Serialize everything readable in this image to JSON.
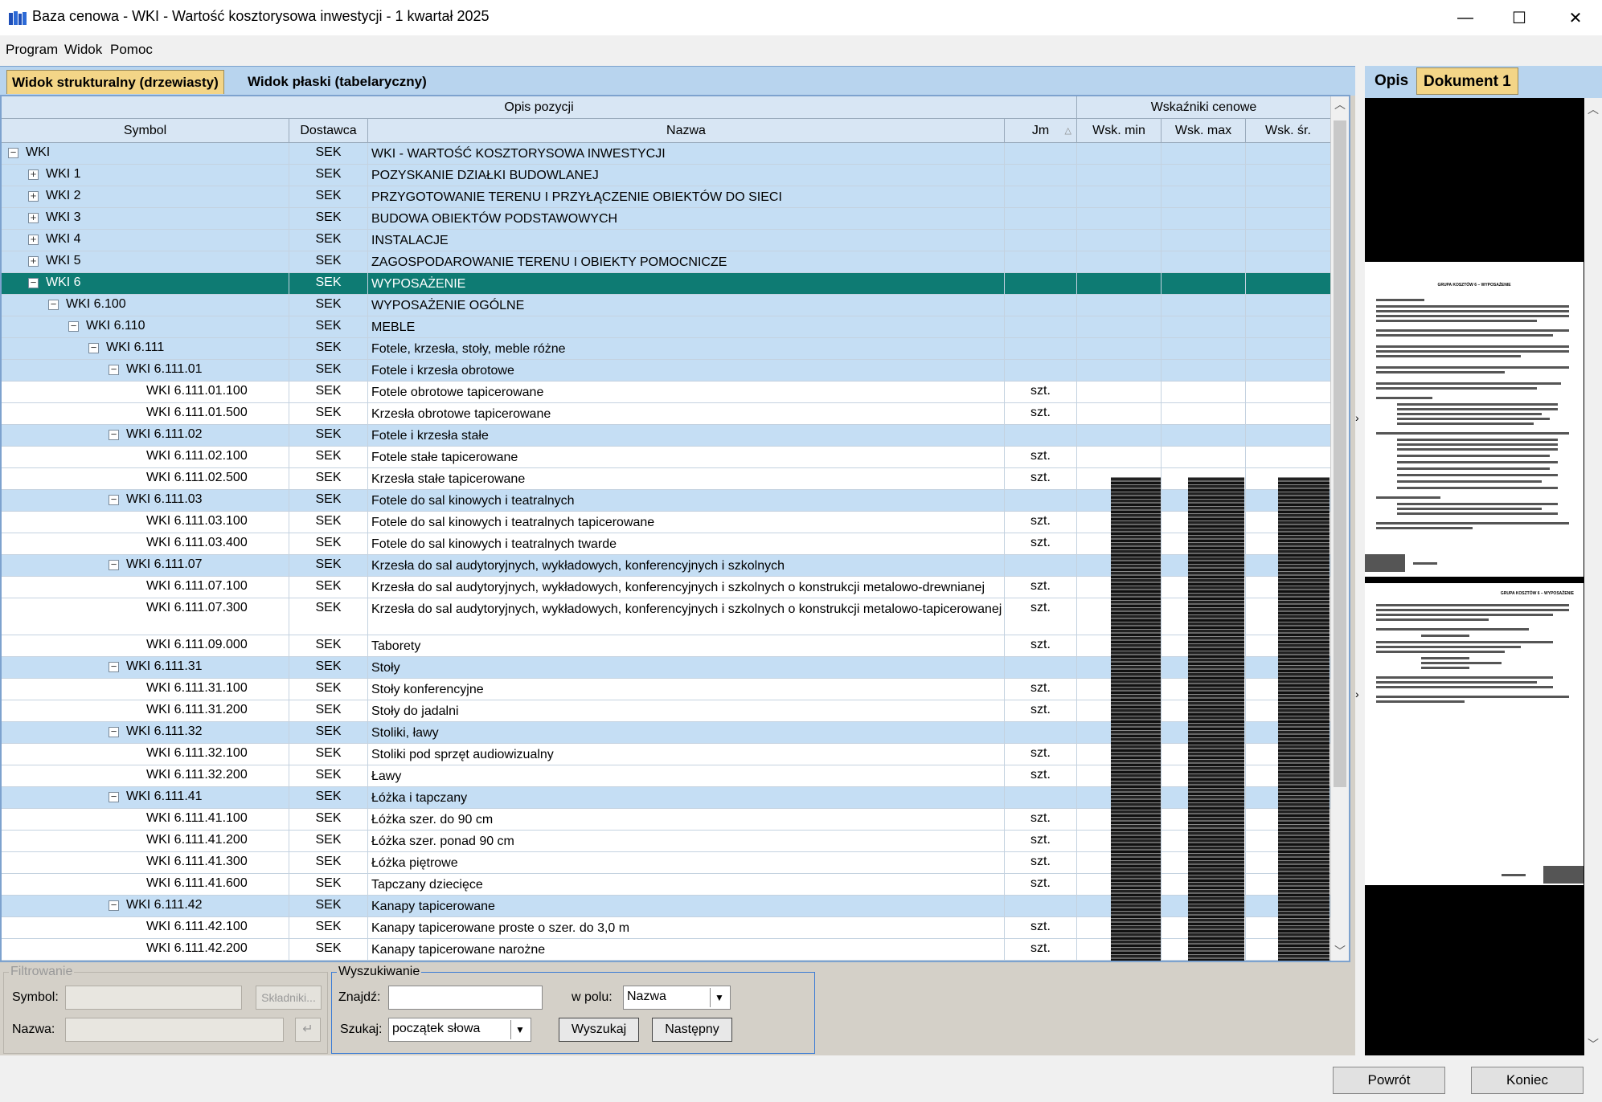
{
  "window": {
    "title": "Baza cenowa - WKI - Wartość kosztorysowa inwestycji - 1 kwartał 2025",
    "minimize": "—",
    "maximize": "☐",
    "close": "✕"
  },
  "menu": [
    {
      "label": "Program"
    },
    {
      "label": "Widok"
    },
    {
      "label": "Pomoc"
    }
  ],
  "tabs": [
    {
      "label": "Widok strukturalny (drzewiasty)"
    },
    {
      "label": "Widok płaski (tabelaryczny)"
    }
  ],
  "grid": {
    "group_headers": {
      "opis": "Opis pozycji",
      "wsk": "Wskaźniki cenowe"
    },
    "columns": {
      "symbol": "Symbol",
      "dostawca": "Dostawca",
      "nazwa": "Nazwa",
      "jm": "Jm",
      "wsk_min": "Wsk. min",
      "wsk_max": "Wsk. max",
      "wsk_sr": "Wsk. śr."
    },
    "rows": [
      {
        "symbol": "WKI",
        "dostawca": "SEK",
        "nazwa": "WKI - WARTOŚĆ KOSZTORYSOWA INWESTYCJI",
        "jm": "",
        "level": 0,
        "type": "group",
        "exp": "−"
      },
      {
        "symbol": "WKI 1",
        "dostawca": "SEK",
        "nazwa": "POZYSKANIE DZIAŁKI BUDOWLANEJ",
        "jm": "",
        "level": 1,
        "type": "group",
        "exp": "+"
      },
      {
        "symbol": "WKI 2",
        "dostawca": "SEK",
        "nazwa": "PRZYGOTOWANIE TERENU I PRZYŁĄCZENIE OBIEKTÓW DO SIECI",
        "jm": "",
        "level": 1,
        "type": "group",
        "exp": "+"
      },
      {
        "symbol": "WKI 3",
        "dostawca": "SEK",
        "nazwa": "BUDOWA OBIEKTÓW PODSTAWOWYCH",
        "jm": "",
        "level": 1,
        "type": "group",
        "exp": "+"
      },
      {
        "symbol": "WKI 4",
        "dostawca": "SEK",
        "nazwa": "INSTALACJE",
        "jm": "",
        "level": 1,
        "type": "group",
        "exp": "+"
      },
      {
        "symbol": "WKI 5",
        "dostawca": "SEK",
        "nazwa": "ZAGOSPODAROWANIE TERENU I OBIEKTY POMOCNICZE",
        "jm": "",
        "level": 1,
        "type": "group",
        "exp": "+"
      },
      {
        "symbol": "WKI 6",
        "dostawca": "SEK",
        "nazwa": "WYPOSAŻENIE",
        "jm": "",
        "level": 1,
        "type": "selected",
        "exp": "−"
      },
      {
        "symbol": "WKI 6.100",
        "dostawca": "SEK",
        "nazwa": "WYPOSAŻENIE OGÓLNE",
        "jm": "",
        "level": 2,
        "type": "group",
        "exp": "−"
      },
      {
        "symbol": "WKI 6.110",
        "dostawca": "SEK",
        "nazwa": "MEBLE",
        "jm": "",
        "level": 3,
        "type": "group",
        "exp": "−"
      },
      {
        "symbol": "WKI 6.111",
        "dostawca": "SEK",
        "nazwa": "Fotele, krzesła, stoły, meble różne",
        "jm": "",
        "level": 4,
        "type": "group",
        "exp": "−"
      },
      {
        "symbol": "WKI 6.111.01",
        "dostawca": "SEK",
        "nazwa": "Fotele i krzesła obrotowe",
        "jm": "",
        "level": 5,
        "type": "group",
        "exp": "−"
      },
      {
        "symbol": "WKI 6.111.01.100",
        "dostawca": "SEK",
        "nazwa": "Fotele obrotowe tapicerowane",
        "jm": "szt.",
        "level": 6,
        "type": "leaf",
        "exp": ""
      },
      {
        "symbol": "WKI 6.111.01.500",
        "dostawca": "SEK",
        "nazwa": "Krzesła obrotowe tapicerowane",
        "jm": "szt.",
        "level": 6,
        "type": "leaf",
        "exp": ""
      },
      {
        "symbol": "WKI 6.111.02",
        "dostawca": "SEK",
        "nazwa": "Fotele i krzesła stałe",
        "jm": "",
        "level": 5,
        "type": "group",
        "exp": "−"
      },
      {
        "symbol": "WKI 6.111.02.100",
        "dostawca": "SEK",
        "nazwa": "Fotele stałe tapicerowane",
        "jm": "szt.",
        "level": 6,
        "type": "leaf",
        "exp": ""
      },
      {
        "symbol": "WKI 6.111.02.500",
        "dostawca": "SEK",
        "nazwa": "Krzesła stałe tapicerowane",
        "jm": "szt.",
        "level": 6,
        "type": "leaf",
        "exp": ""
      },
      {
        "symbol": "WKI 6.111.03",
        "dostawca": "SEK",
        "nazwa": "Fotele do sal kinowych i teatralnych",
        "jm": "",
        "level": 5,
        "type": "group",
        "exp": "−"
      },
      {
        "symbol": "WKI 6.111.03.100",
        "dostawca": "SEK",
        "nazwa": "Fotele do sal kinowych i teatralnych tapicerowane",
        "jm": "szt.",
        "level": 6,
        "type": "leaf",
        "exp": ""
      },
      {
        "symbol": "WKI 6.111.03.400",
        "dostawca": "SEK",
        "nazwa": "Fotele do sal kinowych i teatralnych twarde",
        "jm": "szt.",
        "level": 6,
        "type": "leaf",
        "exp": ""
      },
      {
        "symbol": "WKI 6.111.07",
        "dostawca": "SEK",
        "nazwa": "Krzesła do sal audytoryjnych, wykładowych, konferencyjnych i szkolnych",
        "jm": "",
        "level": 5,
        "type": "group",
        "exp": "−"
      },
      {
        "symbol": "WKI 6.111.07.100",
        "dostawca": "SEK",
        "nazwa": "Krzesła do sal audytoryjnych, wykładowych, konferencyjnych i szkolnych o konstrukcji metalowo-drewnianej",
        "jm": "szt.",
        "level": 6,
        "type": "leaf",
        "exp": ""
      },
      {
        "symbol": "WKI 6.111.07.300",
        "dostawca": "SEK",
        "nazwa": "Krzesła do sal audytoryjnych, wykładowych, konferencyjnych i szkolnych o konstrukcji metalowo-tapicerowanej",
        "jm": "szt.",
        "level": 6,
        "type": "leaf tall",
        "exp": ""
      },
      {
        "symbol": "WKI 6.111.09.000",
        "dostawca": "SEK",
        "nazwa": "Taborety",
        "jm": "szt.",
        "level": 6,
        "type": "leaf",
        "exp": ""
      },
      {
        "symbol": "WKI 6.111.31",
        "dostawca": "SEK",
        "nazwa": "Stoły",
        "jm": "",
        "level": 5,
        "type": "group",
        "exp": "−"
      },
      {
        "symbol": "WKI 6.111.31.100",
        "dostawca": "SEK",
        "nazwa": "Stoły konferencyjne",
        "jm": "szt.",
        "level": 6,
        "type": "leaf",
        "exp": ""
      },
      {
        "symbol": "WKI 6.111.31.200",
        "dostawca": "SEK",
        "nazwa": "Stoły do jadalni",
        "jm": "szt.",
        "level": 6,
        "type": "leaf",
        "exp": ""
      },
      {
        "symbol": "WKI 6.111.32",
        "dostawca": "SEK",
        "nazwa": "Stoliki, ławy",
        "jm": "",
        "level": 5,
        "type": "group",
        "exp": "−"
      },
      {
        "symbol": "WKI 6.111.32.100",
        "dostawca": "SEK",
        "nazwa": "Stoliki pod sprzęt audiowizualny",
        "jm": "szt.",
        "level": 6,
        "type": "leaf",
        "exp": ""
      },
      {
        "symbol": "WKI 6.111.32.200",
        "dostawca": "SEK",
        "nazwa": "Ławy",
        "jm": "szt.",
        "level": 6,
        "type": "leaf",
        "exp": ""
      },
      {
        "symbol": "WKI 6.111.41",
        "dostawca": "SEK",
        "nazwa": "Łóżka i tapczany",
        "jm": "",
        "level": 5,
        "type": "group",
        "exp": "−"
      },
      {
        "symbol": "WKI 6.111.41.100",
        "dostawca": "SEK",
        "nazwa": "Łóżka szer. do 90 cm",
        "jm": "szt.",
        "level": 6,
        "type": "leaf",
        "exp": ""
      },
      {
        "symbol": "WKI 6.111.41.200",
        "dostawca": "SEK",
        "nazwa": "Łóżka szer. ponad 90 cm",
        "jm": "szt.",
        "level": 6,
        "type": "leaf",
        "exp": ""
      },
      {
        "symbol": "WKI 6.111.41.300",
        "dostawca": "SEK",
        "nazwa": "Łóżka piętrowe",
        "jm": "szt.",
        "level": 6,
        "type": "leaf",
        "exp": ""
      },
      {
        "symbol": "WKI 6.111.41.600",
        "dostawca": "SEK",
        "nazwa": "Tapczany dziecięce",
        "jm": "szt.",
        "level": 6,
        "type": "leaf",
        "exp": ""
      },
      {
        "symbol": "WKI 6.111.42",
        "dostawca": "SEK",
        "nazwa": "Kanapy tapicerowane",
        "jm": "",
        "level": 5,
        "type": "group",
        "exp": "−"
      },
      {
        "symbol": "WKI 6.111.42.100",
        "dostawca": "SEK",
        "nazwa": "Kanapy tapicerowane proste o szer. do 3,0 m",
        "jm": "szt.",
        "level": 6,
        "type": "leaf",
        "exp": ""
      },
      {
        "symbol": "WKI 6.111.42.200",
        "dostawca": "SEK",
        "nazwa": "Kanapy tapicerowane narożne",
        "jm": "szt.",
        "level": 6,
        "type": "leaf",
        "exp": ""
      }
    ]
  },
  "filter": {
    "legend": "Filtrowanie",
    "symbol_label": "Symbol:",
    "name_label": "Nazwa:",
    "components_btn": "Składniki...",
    "small_btn": "↵"
  },
  "search": {
    "legend": "Wyszukiwanie",
    "find_label": "Znajdź:",
    "field_label": "w polu:",
    "field_value": "Nazwa",
    "mode_label": "Szukaj:",
    "mode_value": "początek słowa",
    "search_btn": "Wyszukaj",
    "next_btn": "Następny"
  },
  "right": {
    "tabs": [
      {
        "label": "Opis"
      },
      {
        "label": "Dokument 1"
      }
    ],
    "doc_heading_1": "GRUPA KOSZTÓW 6 – WYPOSAŻENIE",
    "doc_heading_2": "GRUPA KOSZTÓW 6 – WYPOSAŻENIE"
  },
  "footer": {
    "back": "Powrót",
    "end": "Koniec"
  },
  "colors": {
    "selected_row": "#0e7b73",
    "group_row": "#c5def4",
    "active_tab": "#f3d587"
  }
}
